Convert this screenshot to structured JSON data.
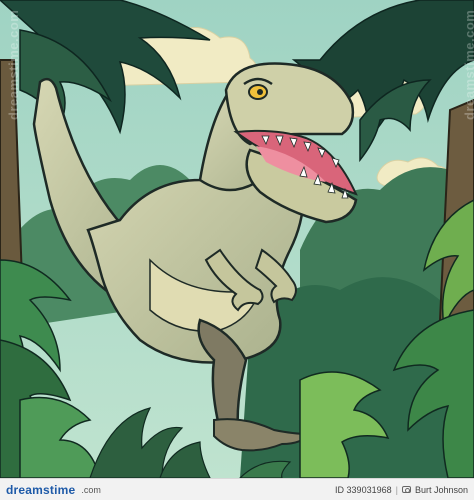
{
  "image": {
    "subject": "T-rex",
    "palette": {
      "sky": "#a9d8c8",
      "cloud": "#f2ecc7",
      "jungle_dark": "#1f4a3b",
      "jungle_mid": "#3f7d55",
      "leaf_light": "#7dbb5a",
      "dino_body": "#c7c9a2",
      "dino_shadow": "#8f9a78",
      "mouth": "#d9657a",
      "outline": "#1e2a26"
    }
  },
  "watermark": {
    "text": "dreamstime.com"
  },
  "footer": {
    "brand_part1": "dreams",
    "brand_part2": "time",
    "url": ".com",
    "id_text": "ID 339031968",
    "author": "Burt Johnson"
  }
}
